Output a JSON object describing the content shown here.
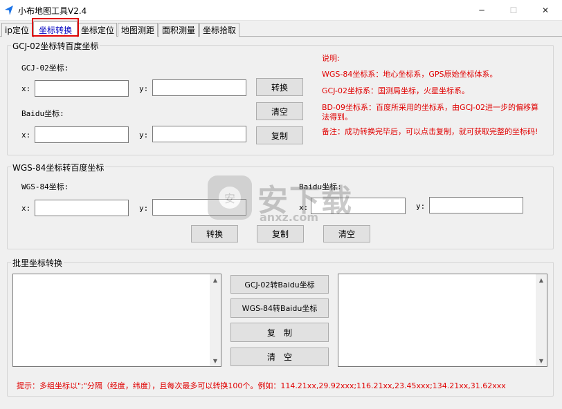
{
  "window": {
    "title": "小布地图工具V2.4",
    "minimize": "─",
    "maximize": "☐",
    "close": "✕"
  },
  "tabs": [
    {
      "label": "ip定位"
    },
    {
      "label": "坐标转换"
    },
    {
      "label": "坐标定位"
    },
    {
      "label": "地图测距"
    },
    {
      "label": "面积测量"
    },
    {
      "label": "坐标拾取"
    }
  ],
  "gcj_section": {
    "title": "GCJ-02坐标转百度坐标",
    "gcj_label": "GCJ-02坐标:",
    "baidu_label": "Baidu坐标:",
    "x_label": "x:",
    "y_label": "y:",
    "convert": "转换",
    "clear": "清空",
    "copy": "复制"
  },
  "notes": {
    "title": "说明:",
    "line1": "WGS-84坐标系：地心坐标系，GPS原始坐标体系。",
    "line2": "GCJ-02坐标系：国测局坐标，火星坐标系。",
    "line3": "BD-09坐标系：百度所采用的坐标系，由GCJ-02进一步的偏移算法得到。",
    "line4": "备注：成功转换完毕后，可以点击复制，就可获取完整的坐标码!"
  },
  "wgs_section": {
    "title": "WGS-84坐标转百度坐标",
    "wgs_label": "WGS-84坐标:",
    "baidu_label": "Baidu坐标:",
    "x_label": "x:",
    "y_label": "y:",
    "convert": "转换",
    "copy": "复制",
    "clear": "清空"
  },
  "batch_section": {
    "title": "批里坐标转换",
    "gcj_to_baidu": "GCJ-02转Baidu坐标",
    "wgs_to_baidu": "WGS-84转Baidu坐标",
    "copy": "复　制",
    "clear": "清　空"
  },
  "hint": "提示：多组坐标以\";\"分隔（经度，纬度），且每次最多可以转换100个。例如：114.21xx,29.92xxx;116.21xx,23.45xxx;134.21xx,31.62xxx",
  "watermark": {
    "text": "安下载",
    "sub": "anxz.com",
    "badge": "安"
  },
  "colors": {
    "accent": "#0000c0",
    "note_red": "#e00000",
    "highlight": "#e00000",
    "app_icon": "#1a73e8"
  }
}
